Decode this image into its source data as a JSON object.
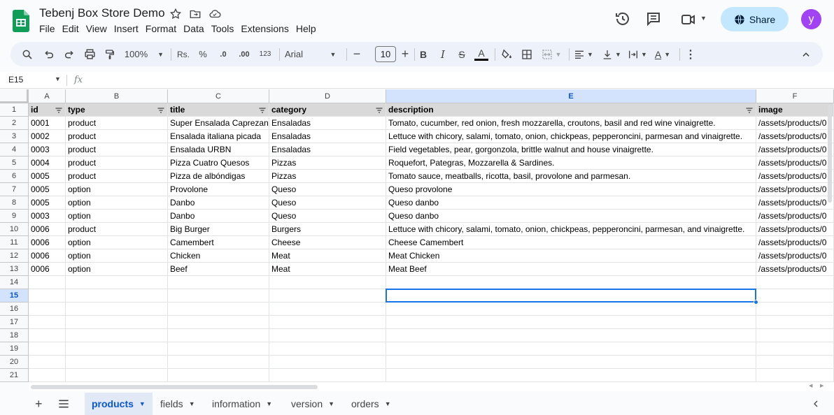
{
  "doc": {
    "title": "Tebenj Box Store Demo"
  },
  "menu": [
    "File",
    "Edit",
    "View",
    "Insert",
    "Format",
    "Data",
    "Tools",
    "Extensions",
    "Help"
  ],
  "share": {
    "label": "Share"
  },
  "user": {
    "initial": "y"
  },
  "toolbar": {
    "zoom": "100%",
    "currency": "Rs.",
    "percent": "%",
    "dec_decrease": ".0",
    "dec_increase": ".00",
    "format_123": "123",
    "font": "Arial",
    "font_size": "10"
  },
  "formula": {
    "cell_ref": "E15",
    "fx": "fx",
    "value": ""
  },
  "columns": [
    {
      "letter": "A"
    },
    {
      "letter": "B"
    },
    {
      "letter": "C"
    },
    {
      "letter": "D"
    },
    {
      "letter": "E"
    },
    {
      "letter": "F"
    }
  ],
  "header_row": [
    "id",
    "type",
    "title",
    "category",
    "description",
    "image"
  ],
  "rows": [
    [
      "0001",
      "product",
      "Super Ensalada Caprezana",
      "Ensaladas",
      "Tomato, cucumber, red onion, fresh mozzarella, croutons, basil and red wine vinaigrette.",
      "/assets/products/0"
    ],
    [
      "0002",
      "product",
      "Ensalada italiana picada",
      "Ensaladas",
      "Lettuce with chicory, salami, tomato, onion, chickpeas, pepperoncini, parmesan and vinaigrette.",
      "/assets/products/0"
    ],
    [
      "0003",
      "product",
      "Ensalada URBN",
      "Ensaladas",
      "Field vegetables, pear, gorgonzola, brittle walnut and house vinaigrette.",
      "/assets/products/0"
    ],
    [
      "0004",
      "product",
      "Pizza Cuatro Quesos",
      "Pizzas",
      "Roquefort, Pategras, Mozzarella & Sardines.",
      "/assets/products/0"
    ],
    [
      "0005",
      "product",
      "Pizza de albóndigas",
      "Pizzas",
      "Tomato sauce, meatballs, ricotta, basil, provolone and parmesan.",
      "/assets/products/0"
    ],
    [
      "0005",
      "option",
      "Provolone",
      "Queso",
      "Queso provolone",
      "/assets/products/0"
    ],
    [
      "0005",
      "option",
      "Danbo",
      "Queso",
      "Queso danbo",
      "/assets/products/0"
    ],
    [
      "0003",
      "option",
      "Danbo",
      "Queso",
      "Queso danbo",
      "/assets/products/0"
    ],
    [
      "0006",
      "product",
      "Big Burger",
      "Burgers",
      "Lettuce with chicory, salami, tomato, onion, chickpeas, pepperoncini, parmesan, and vinaigrette.",
      "/assets/products/0"
    ],
    [
      "0006",
      "option",
      "Camembert",
      "Cheese",
      "Cheese Camembert",
      "/assets/products/0"
    ],
    [
      "0006",
      "option",
      "Chicken",
      "Meat",
      "Meat Chicken",
      "/assets/products/0"
    ],
    [
      "0006",
      "option",
      "Beef",
      "Meat",
      "Meat Beef",
      "/assets/products/0"
    ]
  ],
  "row_numbers": [
    "1",
    "2",
    "3",
    "4",
    "5",
    "6",
    "7",
    "8",
    "9",
    "10",
    "11",
    "12",
    "13",
    "14",
    "15",
    "16",
    "17",
    "18",
    "19",
    "20",
    "21"
  ],
  "selected": {
    "col": "E",
    "row": "15"
  },
  "sheets": [
    {
      "name": "products",
      "active": true
    },
    {
      "name": "fields",
      "active": false
    },
    {
      "name": "information",
      "active": false
    },
    {
      "name": "version",
      "active": false
    },
    {
      "name": "orders",
      "active": false
    }
  ],
  "colors": {
    "accent": "#1a73e8",
    "share_bg": "#c2e7ff",
    "avatar": "#a142f4",
    "sheets_green": "#0f9d58"
  }
}
